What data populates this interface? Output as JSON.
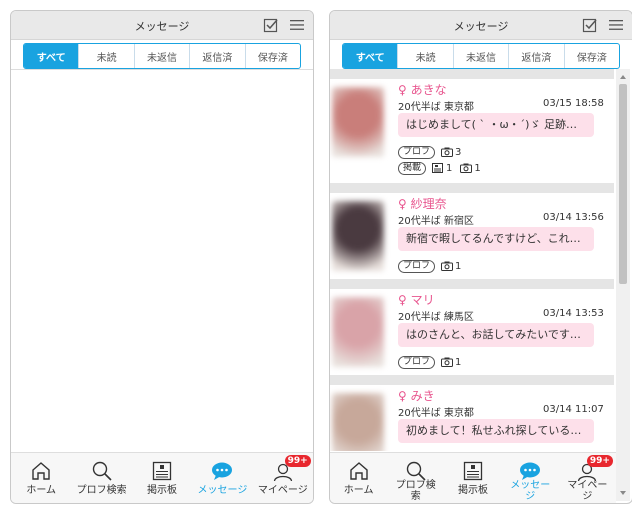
{
  "header": {
    "title": "メッセージ"
  },
  "tabs": [
    "すべて",
    "未読",
    "未返信",
    "返信済",
    "保存済"
  ],
  "active_tab": 0,
  "nav": {
    "items": [
      {
        "label": "ホーム",
        "icon": "home-icon"
      },
      {
        "label": "プロフ検索",
        "icon": "search-icon"
      },
      {
        "label": "掲示板",
        "icon": "board-icon"
      },
      {
        "label": "メッセージ",
        "icon": "chat-icon"
      },
      {
        "label": "マイページ",
        "icon": "user-icon"
      }
    ],
    "right_labels": [
      "ホーム",
      "プロフ検\n索",
      "掲示板",
      "メッセー\nジ",
      "マイペー\nジ"
    ],
    "badge": "99+"
  },
  "messages": [
    {
      "name": "♀ あきな",
      "meta": "20代半ば 東京都",
      "time": "03/15 18:58",
      "preview": "はじめまして( ` ・ω・´)ゞ 足跡…",
      "chip": "プロフ",
      "photo_count": "3",
      "chip2": "掲載",
      "board_count": "1",
      "photo_count2": "1",
      "avatar_color": "#c97e7a"
    },
    {
      "name": "♀ 紗理奈",
      "meta": "20代半ば 新宿区",
      "time": "03/14 13:56",
      "preview": "新宿で暇してるんですけど、これ…",
      "chip": "プロフ",
      "photo_count": "1",
      "avatar_color": "#4a3a40"
    },
    {
      "name": "♀ マリ",
      "meta": "20代半ば 練馬区",
      "time": "03/14 13:53",
      "preview": "はのさんと、お話してみたいです…",
      "chip": "プロフ",
      "photo_count": "1",
      "avatar_color": "#d9a3a8"
    },
    {
      "name": "♀ みき",
      "meta": "20代半ば 東京都",
      "time": "03/14 11:07",
      "preview": "初めまして！私せふれ探している…",
      "chip": "プロフ",
      "photo_count": "1",
      "avatar_color": "#c7a89a"
    }
  ]
}
